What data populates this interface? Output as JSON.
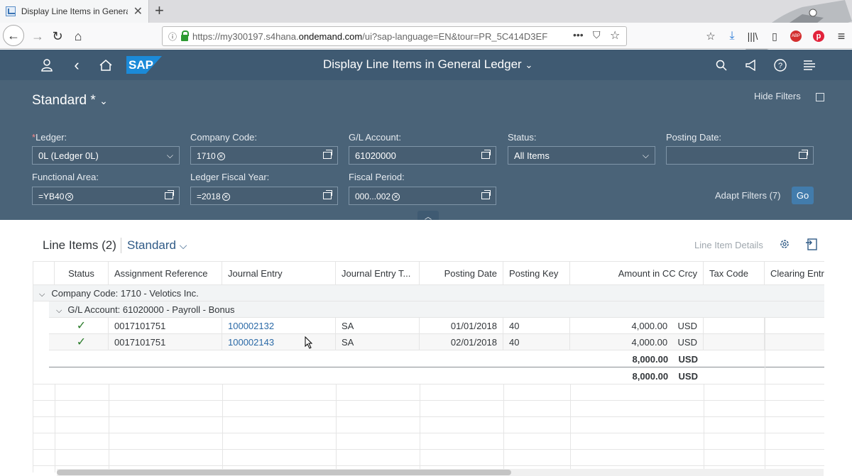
{
  "browser": {
    "tab_title": "Display Line Items in General Ledger",
    "url_prefix": "https://my300197.s4hana.",
    "url_domain": "ondemand.com",
    "url_suffix": "/ui?sap-language=EN&tour=PR_5C414D3EF",
    "toolbar_icons": [
      "back-icon",
      "forward-icon",
      "reload-icon",
      "home-icon",
      "info-icon",
      "lock-icon",
      "more-icon",
      "pocket-icon",
      "bookmark-star-icon",
      "bookmark-manager-icon",
      "download-icon",
      "library-icon",
      "sidebar-icon",
      "adblock-icon",
      "pinterest-icon",
      "menu-icon"
    ]
  },
  "shell": {
    "title": "Display Line Items in General Ledger",
    "logo": "SAP"
  },
  "filters": {
    "variant": "Standard *",
    "hide_filters": "Hide Filters",
    "ledger_label": "Ledger:",
    "ledger_required": "*",
    "ledger_value": "0L (Ledger 0L)",
    "company_code_label": "Company Code:",
    "company_code_token": "1710",
    "gl_account_label": "G/L Account:",
    "gl_account_value": "61020000",
    "status_label": "Status:",
    "status_value": "All Items",
    "posting_date_label": "Posting Date:",
    "posting_date_value": "",
    "functional_area_label": "Functional Area:",
    "functional_area_token": "=YB40",
    "fiscal_year_label": "Ledger Fiscal Year:",
    "fiscal_year_token": "=2018",
    "fiscal_period_label": "Fiscal Period:",
    "fiscal_period_token": "000...002",
    "adapt_filters": "Adapt Filters (7)",
    "go": "Go"
  },
  "table": {
    "title": "Line Items (2)",
    "variant": "Standard",
    "line_item_details": "Line Item Details",
    "columns": [
      "Status",
      "Assignment Reference",
      "Journal Entry",
      "Journal Entry T...",
      "Posting Date",
      "Posting Key",
      "Amount in CC Crcy",
      "Tax Code",
      "Clearing Entry"
    ],
    "group1": "Company Code: 1710 - Velotics Inc.",
    "group2": "G/L Account: 61020000 - Payroll - Bonus",
    "rows": [
      {
        "status": "✓",
        "assignment": "0017101751",
        "journal_entry": "100002132",
        "je_type": "SA",
        "posting_date": "01/01/2018",
        "posting_key": "40",
        "amount": "4,000.00",
        "currency": "USD"
      },
      {
        "status": "✓",
        "assignment": "0017101751",
        "journal_entry": "100002143",
        "je_type": "SA",
        "posting_date": "02/01/2018",
        "posting_key": "40",
        "amount": "4,000.00",
        "currency": "USD"
      }
    ],
    "subtotal": {
      "amount": "8,000.00",
      "currency": "USD"
    },
    "total": {
      "amount": "8,000.00",
      "currency": "USD"
    }
  }
}
